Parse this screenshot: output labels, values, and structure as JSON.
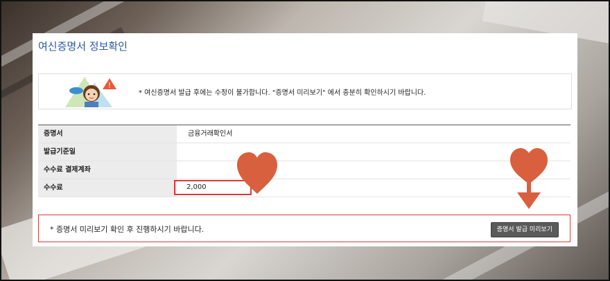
{
  "page": {
    "title": "여신증명서 정보확인"
  },
  "notice": {
    "text": "* 여신증명서 발급 후에는 수정이 불가합니다. \"증명서 미리보기\" 에서 충분히 확인하시기 바랍니다."
  },
  "table": {
    "rows": [
      {
        "label": "증명서",
        "value": "금융거래확인서"
      },
      {
        "label": "발급기준일",
        "value": ""
      },
      {
        "label": "수수료 결제계좌",
        "value": ""
      },
      {
        "label": "수수료",
        "value": "2,000"
      }
    ]
  },
  "footer": {
    "text": "* 증명서 미리보기 확인 후 진행하시기 바랍니다.",
    "preview_button": "증명서 발급 미리보기"
  },
  "colors": {
    "title": "#2a5aa0",
    "highlight_border": "#d83a3a",
    "heart": "#d9603e",
    "button_bg": "#5a5a5a"
  }
}
